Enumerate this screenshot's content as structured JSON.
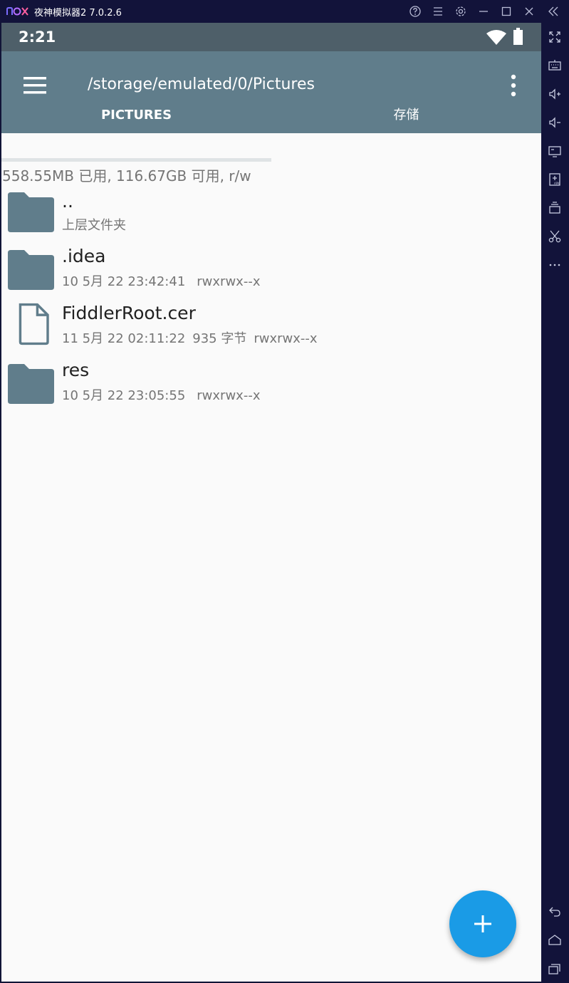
{
  "emulator": {
    "title": "夜神模拟器2 7.0.2.6",
    "titlebar_icons": [
      "help-icon",
      "menu-icon",
      "settings-icon",
      "minimize-icon",
      "maximize-icon",
      "close-icon",
      "collapse-icon"
    ],
    "sidebar_icons": [
      "fullscreen-icon",
      "keyboard-icon",
      "volume-up-icon",
      "volume-down-icon",
      "screen-icon",
      "apk-install-icon",
      "multi-instance-icon",
      "cut-icon",
      "more-icon",
      "back-icon",
      "home-icon",
      "recents-icon"
    ]
  },
  "status_bar": {
    "time": "2:21"
  },
  "app_bar": {
    "path": "/storage/emulated/0/Pictures"
  },
  "tabs": [
    {
      "label": "PICTURES",
      "active": true
    },
    {
      "label": "存储",
      "active": false
    }
  ],
  "storage_usage": "558.55MB 已用, 116.67GB 可用, r/w",
  "files": [
    {
      "name": "..",
      "type": "folder",
      "date": "上层文件夹",
      "size": "",
      "perms": ""
    },
    {
      "name": ".idea",
      "type": "folder",
      "date": "10 5月 22 23:42:41",
      "size": "",
      "perms": "rwxrwx--x"
    },
    {
      "name": "FiddlerRoot.cer",
      "type": "file",
      "date": "11 5月 22 02:11:22",
      "size": "935 字节",
      "perms": "rwxrwx--x"
    },
    {
      "name": "res",
      "type": "folder",
      "date": "10 5月 22 23:05:55",
      "size": "",
      "perms": "rwxrwx--x"
    }
  ],
  "colors": {
    "app_bar": "#607d8b",
    "status_bar": "#4e5f69",
    "icon": "#607d8b",
    "fab": "#1a9be6",
    "emulator_frame": "#12133a"
  }
}
